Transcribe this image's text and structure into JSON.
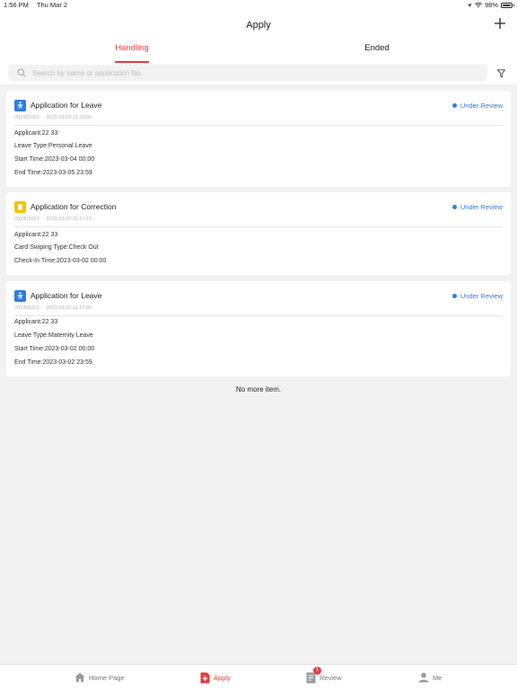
{
  "status_bar": {
    "time": "1:56 PM",
    "date": "Thu Mar 2",
    "battery": "98%"
  },
  "header": {
    "title": "Apply"
  },
  "tabs": [
    {
      "label": "Handling"
    },
    {
      "label": "Ended"
    }
  ],
  "search": {
    "placeholder": "Search by name or application No."
  },
  "cards": [
    {
      "icon": "leave-icon",
      "title": "Application for Leave",
      "status": "Under Review",
      "number": "202303023",
      "timestamp": "2023-03-02 11:23:00",
      "lines": [
        "Applicant:22 33",
        "Leave Type:Personal Leave",
        "Start Time:2023-03-04 00:00",
        "End Time:2023-03-05 23:59"
      ]
    },
    {
      "icon": "correction-icon",
      "title": "Application for Correction",
      "status": "Under Review",
      "number": "202303022",
      "timestamp": "2023-03-02 11:17:13",
      "lines": [
        "Applicant:22 33",
        "Card Swiping Type:Check Out",
        "Check-In Time:2023-03-02 00:00"
      ]
    },
    {
      "icon": "leave-icon",
      "title": "Application for Leave",
      "status": "Under Review",
      "number": "202303021",
      "timestamp": "2023-03-02 11:17:05",
      "lines": [
        "Applicant:22 33",
        "Leave Type:Maternity Leave",
        "Start Time:2023-03-02 00:00",
        "End Time:2023-03-02 23:59"
      ]
    }
  ],
  "list_footer": "No more item.",
  "bottom_nav": [
    {
      "label": "Home Page",
      "icon": "home-icon"
    },
    {
      "label": "Apply",
      "icon": "apply-icon"
    },
    {
      "label": "Review",
      "icon": "review-icon",
      "badge": "1"
    },
    {
      "label": "Me",
      "icon": "user-icon"
    }
  ],
  "colors": {
    "accent": "#e83c3c",
    "status_blue": "#2e7de1",
    "correction_yellow": "#f5c400"
  }
}
